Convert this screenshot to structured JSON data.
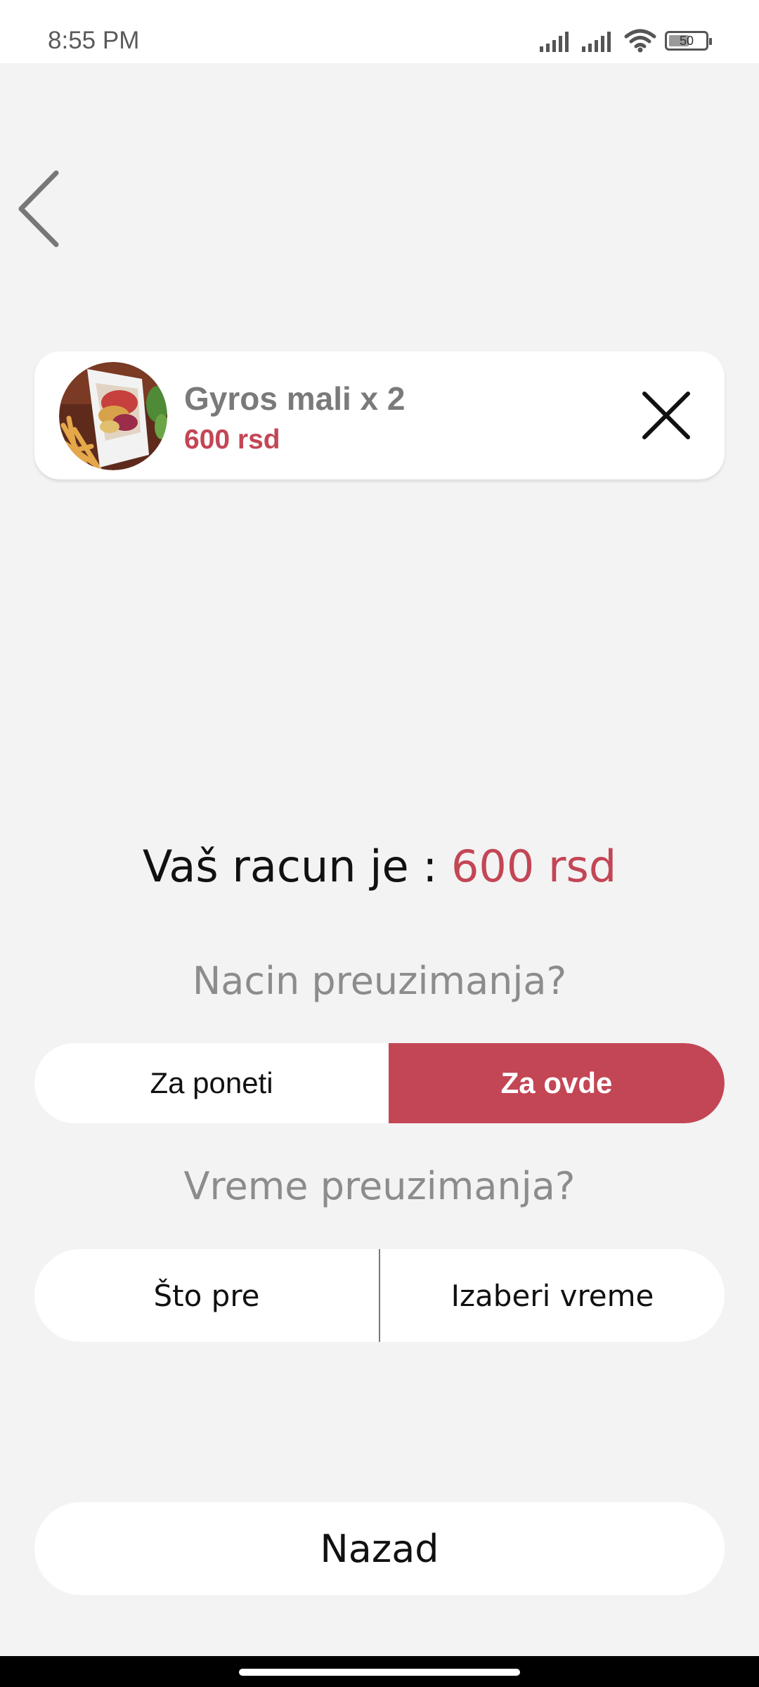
{
  "status_bar": {
    "time": "8:55 PM",
    "battery_level": "50",
    "icons": [
      "signal-icon",
      "signal-icon",
      "wifi-icon",
      "battery-icon"
    ]
  },
  "navigation": {
    "back_icon": "chevron-left-icon"
  },
  "cart_item": {
    "name": "Gyros mali x 2",
    "price": "600 rsd",
    "image": "gyros-with-fries-photo",
    "remove_icon": "close-icon"
  },
  "summary": {
    "total_label": "Vaš racun je :",
    "total_value": "600 rsd"
  },
  "pickup_method": {
    "question": "Nacin preuzimanja?",
    "options": [
      "Za poneti",
      "Za ovde"
    ],
    "selected": "Za ovde"
  },
  "pickup_time": {
    "question": "Vreme preuzimanja?",
    "options": [
      "Što pre",
      "Izaberi vreme"
    ]
  },
  "footer": {
    "back_label": "Nazad"
  },
  "colors": {
    "accent": "#c34655",
    "background": "#f3f3f3",
    "card": "#ffffff",
    "muted_text": "#8c8c8c"
  }
}
